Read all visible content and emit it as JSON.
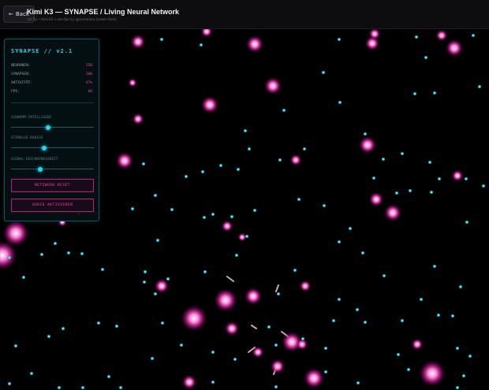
{
  "header": {
    "back_label": "Back",
    "title": "Kimi K3 — SYNAPSE / Living Neural Network",
    "subtitle": "1st Try • Kimi K3 • one-fps try (generations broken.html)"
  },
  "panel": {
    "title": "SYNAPSE // v2.1",
    "stats": [
      {
        "label": "NEURONEN:",
        "value": "250"
      },
      {
        "label": "SYNAPSEN:",
        "value": "160"
      },
      {
        "label": "AKTIVITÄT:",
        "value": "47%"
      },
      {
        "label": "FPS:",
        "value": "60"
      }
    ],
    "sliders": [
      {
        "label": "SCHWARM-INTELLIGENZ",
        "level": 0.45
      },
      {
        "label": "STIMULUS-RADIUS",
        "level": 0.4
      },
      {
        "label": "SIGNAL-GESCHWINDIGKEIT",
        "level": 0.35
      }
    ],
    "reset_label": "NETZWERK RESET",
    "audio_label": "AUDIO AKTIVIEREN"
  },
  "colors": {
    "cyan": "#22d8ec",
    "magenta": "#ff3fb4"
  }
}
